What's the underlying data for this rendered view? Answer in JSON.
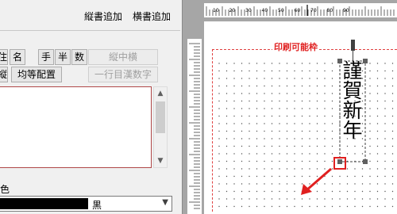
{
  "header": {
    "vertical_add": "縦書追加",
    "horizontal_add": "横書追加"
  },
  "toolbar": {
    "row1": {
      "partial_left": "住",
      "name": "名",
      "hand": "手",
      "half": "半",
      "number": "数",
      "vertical_in_horizontal": "縦中横"
    },
    "row2": {
      "partial_left": "縦",
      "equal_layout": "均等配置",
      "kanji_numerals": "一行目漢数字"
    }
  },
  "text_area": {
    "value": ""
  },
  "color": {
    "label": "色",
    "selected": "黒",
    "swatch_color": "#000000"
  },
  "canvas": {
    "print_area_label": "印刷可能枠",
    "text_frame_text": "謹賀新年",
    "ruler_numbers": [
      "10",
      "20",
      "30",
      "40",
      "50",
      "60",
      "70",
      "80",
      "90"
    ]
  },
  "colors": {
    "print_area_border": "#e04040",
    "selection_marker": "#e02020",
    "arrow": "#e02020",
    "textbox_border": "#b04848"
  },
  "icons": {
    "scroll_up": "chevron-up-icon",
    "scroll_down": "chevron-down-icon",
    "dropdown": "chevron-down-icon",
    "arrow": "red-arrow-icon"
  }
}
